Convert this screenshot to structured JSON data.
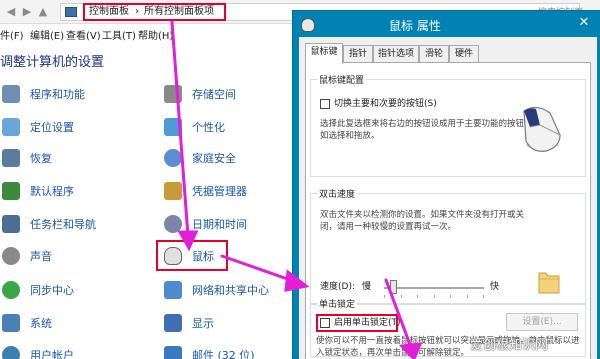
{
  "address_bar": {
    "back_icon": "back-arrow-icon",
    "forward_icon": "forward-arrow-icon",
    "up_icon": "up-arrow-icon",
    "crumbs": [
      "控制面板",
      "所有控制面板项"
    ],
    "search_placeholder": "搜索控制面"
  },
  "menu": [
    "件(F)",
    "编辑(E)",
    "查看(V)",
    "工具(T)",
    "帮助(H)"
  ],
  "page_title": "调整计算机的设置",
  "left_items": [
    {
      "label": "程序和功能",
      "icon": "programs-icon",
      "color": "#6e8fb3"
    },
    {
      "label": "定位设置",
      "icon": "location-icon",
      "color": "#6aa6d8"
    },
    {
      "label": "恢复",
      "icon": "recovery-icon",
      "color": "#5a7d9e"
    },
    {
      "label": "默认程序",
      "icon": "default-programs-icon",
      "color": "#3d8a3d"
    },
    {
      "label": "任务栏和导航",
      "icon": "taskbar-icon",
      "color": "#4a6f92"
    },
    {
      "label": "声音",
      "icon": "sound-icon",
      "color": "#8a8a8a"
    },
    {
      "label": "同步中心",
      "icon": "sync-center-icon",
      "color": "#3aa64a"
    },
    {
      "label": "系统",
      "icon": "system-icon",
      "color": "#4a7fb8"
    },
    {
      "label": "用户帐户",
      "icon": "user-accounts-icon",
      "color": "#3f7fb0"
    }
  ],
  "right_items": [
    {
      "label": "存储空间",
      "icon": "storage-icon",
      "color": "#8a8a8a"
    },
    {
      "label": "个性化",
      "icon": "personalization-icon",
      "color": "#4f9bd6"
    },
    {
      "label": "家庭安全",
      "icon": "family-safety-icon",
      "color": "#5b8ed0"
    },
    {
      "label": "凭据管理器",
      "icon": "credential-manager-icon",
      "color": "#c89a3a"
    },
    {
      "label": "日期和时间",
      "icon": "date-time-icon",
      "color": "#7a86a8"
    },
    {
      "label": "鼠标",
      "icon": "mouse-icon",
      "color": "#d8d8d8"
    },
    {
      "label": "网络和共享中心",
      "icon": "network-icon",
      "color": "#4f8ad0"
    },
    {
      "label": "显示",
      "icon": "display-icon",
      "color": "#3f6fb0"
    },
    {
      "label": "邮件 (32 位)",
      "icon": "mail-icon",
      "color": "#3a78c0"
    }
  ],
  "dialog": {
    "title": "鼠标 属性",
    "close_label": "✕",
    "tabs": [
      "鼠标键",
      "指针",
      "指针选项",
      "滑轮",
      "硬件"
    ],
    "button_config": {
      "title": "鼠标键配置",
      "checkbox_label": "切换主要和次要的按钮(S)",
      "desc": [
        "选择此复选框来将右边的按钮设成用于主要功能的按钮，",
        "如选择和拖放。"
      ],
      "mouse_image": "mouse-image-icon"
    },
    "double_click": {
      "title": "双击速度",
      "desc": [
        "双击文件夹以检测你的设置。如果文件夹没有打开或关",
        "闭，请用一种较慢的设置再试一次。"
      ],
      "speed_label": "速度(D):",
      "slow_label": "慢",
      "fast_label": "快",
      "speed_level": 0.08,
      "folder_image": "folder-icon"
    },
    "click_lock": {
      "title": "单击锁定",
      "checkbox_label": "启用单击锁定(T)",
      "settings_button": "设置(E)...",
      "desc": [
        "使你可以不用一直按着鼠标按钮就可以突出显示或拖拽。单击鼠标以进",
        "入锁定状态，再次单击鼠标可解除锁定。"
      ]
    }
  },
  "watermark": "爱创根知识网",
  "colors": {
    "highlight": "#e6002e",
    "arrow": "#e21ed6",
    "dialog_frame": "#0082b4",
    "link": "#1a56a8"
  }
}
